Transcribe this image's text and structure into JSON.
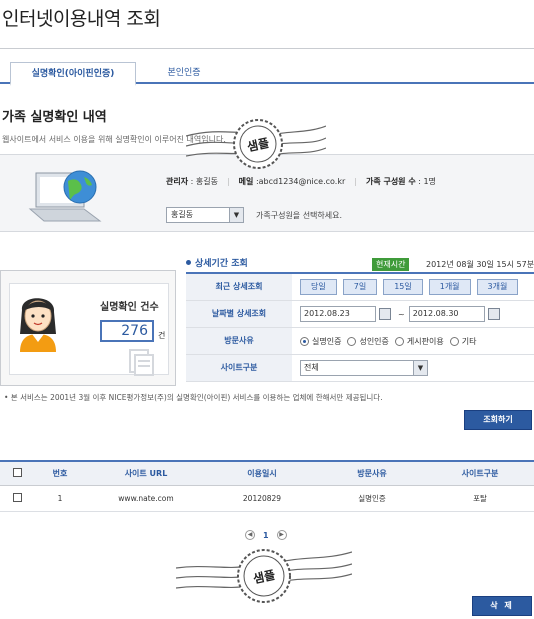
{
  "page_title": "인터넷이용내역 조회",
  "tabs": [
    {
      "label": "실명확인(아이핀인증)",
      "active": true
    },
    {
      "label": "본인인증",
      "active": false
    }
  ],
  "family_section": {
    "title": "가족 실명확인 내역",
    "description": "웹사이트에서 서비스 이용을 위해 실명확인이 이루어진 내역입니다.",
    "admin_label": "관리자",
    "admin_value": "홍길동",
    "email_label": "메일",
    "email_value": "abcd1234@nice.co.kr",
    "members_label": "가족 구성원 수",
    "members_value": "1명",
    "selected_member": "홍길동",
    "select_hint": "가족구성원을 선택하세요."
  },
  "stamp_text": "샘플",
  "count_box": {
    "label": "실명확인 건수",
    "value": "276",
    "unit": "건"
  },
  "period": {
    "title": "상세기간 조회",
    "now_badge": "현재시간",
    "now_time": "2012년 08월 30일 15시 57분"
  },
  "filters": {
    "recent_label": "최근 상세조회",
    "recent_buttons": [
      "당일",
      "7일",
      "15일",
      "1개월",
      "3개월"
    ],
    "date_label": "날짜별 상세조회",
    "date_from": "2012.08.23",
    "date_sep": "~",
    "date_to": "2012.08.30",
    "reason_label": "방문사유",
    "reasons": [
      {
        "label": "실명인증",
        "checked": true
      },
      {
        "label": "성인인증",
        "checked": false
      },
      {
        "label": "게시판이용",
        "checked": false
      },
      {
        "label": "기타",
        "checked": false
      }
    ],
    "site_label": "사이트구분",
    "site_value": "전체"
  },
  "notice": "• 본 서비스는 2001년 3월 이후 NICE평가정보(주)의 실명확인(아이핀) 서비스를 이용하는 업체에 한해서만 제공됩니다.",
  "search_button": "조회하기",
  "table": {
    "headers": [
      "번호",
      "사이트 URL",
      "이용일시",
      "방문사유",
      "사이트구분"
    ],
    "rows": [
      {
        "no": "1",
        "url": "www.nate.com",
        "date": "20120829",
        "reason": "실명인증",
        "site_type": "포탈"
      }
    ]
  },
  "pagination": {
    "current": "1"
  },
  "delete_button": "삭 제",
  "colors": {
    "accent": "#2c5aa0",
    "badge_green": "#3f9b3a",
    "header_bg": "#eef1f6"
  }
}
